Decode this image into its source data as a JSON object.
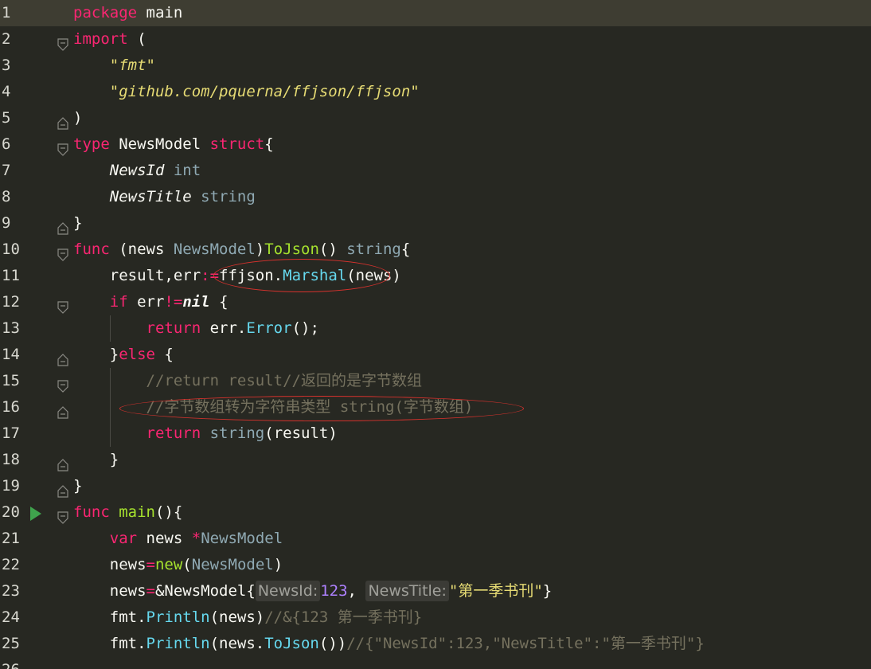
{
  "editor": {
    "language": "Go",
    "theme": "dark",
    "current_line": 1,
    "run_marker_line": 20,
    "lines": [
      {
        "n": "1",
        "t": [
          [
            "kw",
            "package"
          ],
          [
            "",
            " main"
          ]
        ]
      },
      {
        "n": "2",
        "t": [
          [
            "kw",
            "import"
          ],
          [
            "",
            " ("
          ]
        ]
      },
      {
        "n": "3",
        "t": [
          [
            "",
            "    "
          ],
          [
            "str",
            "\"fmt\""
          ]
        ]
      },
      {
        "n": "4",
        "t": [
          [
            "",
            "    "
          ],
          [
            "str",
            "\"github.com/pquerna/ffjson/ffjson\""
          ]
        ]
      },
      {
        "n": "5",
        "t": [
          [
            "",
            ")"
          ]
        ]
      },
      {
        "n": "6",
        "t": [
          [
            "kw",
            "type"
          ],
          [
            "",
            " NewsModel "
          ],
          [
            "kw",
            "struct"
          ],
          [
            "",
            "{"
          ]
        ]
      },
      {
        "n": "7",
        "t": [
          [
            "",
            "    "
          ],
          [
            "fld",
            "NewsId"
          ],
          [
            "ty2",
            " int"
          ]
        ]
      },
      {
        "n": "8",
        "t": [
          [
            "",
            "    "
          ],
          [
            "fld",
            "NewsTitle"
          ],
          [
            "ty2",
            " string"
          ]
        ]
      },
      {
        "n": "9",
        "t": [
          [
            "",
            "}"
          ]
        ]
      },
      {
        "n": "10",
        "t": [
          [
            "kw",
            "func"
          ],
          [
            "",
            " (news "
          ],
          [
            "ty2",
            "NewsModel"
          ],
          [
            "",
            ")"
          ],
          [
            "fn",
            "ToJson"
          ],
          [
            "",
            "() "
          ],
          [
            "ty2",
            "string"
          ],
          [
            "",
            "{"
          ]
        ]
      },
      {
        "n": "11",
        "t": [
          [
            "",
            "    result,err"
          ],
          [
            "op",
            ":="
          ],
          [
            "",
            "ffjson."
          ],
          [
            "mt",
            "Marshal"
          ],
          [
            "",
            "(news)"
          ]
        ]
      },
      {
        "n": "12",
        "t": [
          [
            "",
            "    "
          ],
          [
            "kw",
            "if"
          ],
          [
            "",
            " err"
          ],
          [
            "op",
            "!="
          ],
          [
            "nil",
            "nil"
          ],
          [
            "",
            " {"
          ]
        ]
      },
      {
        "n": "13",
        "t": [
          [
            "",
            "        "
          ],
          [
            "kw",
            "return"
          ],
          [
            "",
            " err."
          ],
          [
            "mt",
            "Error"
          ],
          [
            "",
            "();"
          ]
        ]
      },
      {
        "n": "14",
        "t": [
          [
            "",
            "    }"
          ],
          [
            "kw",
            "else"
          ],
          [
            "",
            " {"
          ]
        ]
      },
      {
        "n": "15",
        "t": [
          [
            "",
            "        "
          ],
          [
            "cmt",
            "//return result//返回的是字节数组"
          ]
        ]
      },
      {
        "n": "16",
        "t": [
          [
            "",
            "        "
          ],
          [
            "cmt",
            "//字节数组转为字符串类型 string(字节数组)"
          ]
        ]
      },
      {
        "n": "17",
        "t": [
          [
            "",
            "        "
          ],
          [
            "kw",
            "return"
          ],
          [
            "",
            " "
          ],
          [
            "ty2",
            "string"
          ],
          [
            "",
            "(result)"
          ]
        ]
      },
      {
        "n": "18",
        "t": [
          [
            "",
            "    }"
          ]
        ]
      },
      {
        "n": "19",
        "t": [
          [
            "",
            "}"
          ]
        ]
      },
      {
        "n": "20",
        "t": [
          [
            "kw",
            "func"
          ],
          [
            "",
            " "
          ],
          [
            "fn",
            "main"
          ],
          [
            "",
            "(){"
          ]
        ]
      },
      {
        "n": "21",
        "t": [
          [
            "",
            "    "
          ],
          [
            "kw",
            "var"
          ],
          [
            "",
            " news "
          ],
          [
            "op",
            "*"
          ],
          [
            "ty2",
            "NewsModel"
          ]
        ]
      },
      {
        "n": "22",
        "t": [
          [
            "",
            "    news"
          ],
          [
            "op",
            "="
          ],
          [
            "fn",
            "new"
          ],
          [
            "",
            "("
          ],
          [
            "ty2",
            "NewsModel"
          ],
          [
            "",
            ")"
          ]
        ]
      },
      {
        "n": "23",
        "t": [
          [
            "",
            "    news"
          ],
          [
            "op",
            "="
          ],
          [
            "",
            "&NewsModel{"
          ],
          [
            "hint",
            "NewsId:"
          ],
          [
            "num",
            "123"
          ],
          [
            "",
            ", "
          ],
          [
            "hint",
            "NewsTitle:"
          ],
          [
            "cnstr",
            "\"第一季书刊\""
          ],
          [
            "",
            "}"
          ]
        ]
      },
      {
        "n": "24",
        "t": [
          [
            "",
            "    fmt."
          ],
          [
            "mt",
            "Println"
          ],
          [
            "",
            "(news)"
          ],
          [
            "cmt",
            "//&{123 第一季书刊}"
          ]
        ]
      },
      {
        "n": "25",
        "t": [
          [
            "",
            "    fmt."
          ],
          [
            "mt",
            "Println"
          ],
          [
            "",
            "(news."
          ],
          [
            "mt",
            "ToJson"
          ],
          [
            "",
            "())"
          ],
          [
            "cmt",
            "//{\"NewsId\":123,\"NewsTitle\":\"第一季书刊\"}"
          ]
        ]
      },
      {
        "n": "26",
        "t": []
      }
    ],
    "fold_markers": [
      {
        "line": "2",
        "kind": "open"
      },
      {
        "line": "5",
        "kind": "close"
      },
      {
        "line": "6",
        "kind": "open"
      },
      {
        "line": "9",
        "kind": "close"
      },
      {
        "line": "10",
        "kind": "open"
      },
      {
        "line": "12",
        "kind": "open"
      },
      {
        "line": "14",
        "kind": "close"
      },
      {
        "line": "15",
        "kind": "open"
      },
      {
        "line": "16",
        "kind": "close"
      },
      {
        "line": "18",
        "kind": "close"
      },
      {
        "line": "19",
        "kind": "close"
      },
      {
        "line": "20",
        "kind": "open"
      }
    ],
    "annotations": [
      {
        "name": "marshal-call-annotation",
        "line": "11"
      },
      {
        "name": "comment-conversion-annotation",
        "line": "16"
      }
    ]
  }
}
